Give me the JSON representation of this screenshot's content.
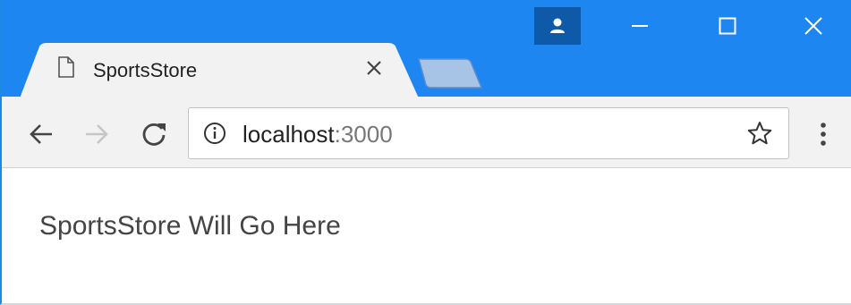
{
  "browser": {
    "tab": {
      "title": "SportsStore",
      "page_icon": "document-icon",
      "close_icon": "close-icon"
    },
    "window_controls": {
      "profile_icon": "person-icon",
      "minimize_icon": "minimize-icon",
      "maximize_icon": "maximize-icon",
      "close_icon": "close-icon"
    },
    "toolbar": {
      "back_icon": "back-arrow-icon",
      "forward_icon": "forward-arrow-icon",
      "reload_icon": "reload-icon",
      "menu_icon": "more-vert-icon"
    },
    "address_bar": {
      "info_icon": "info-icon",
      "host": "localhost",
      "port": ":3000",
      "bookmark_icon": "star-icon"
    }
  },
  "page": {
    "heading": "SportsStore Will Go Here"
  },
  "colors": {
    "titlebar": "#1e86f0",
    "profile_button": "#0f5aa8",
    "toolbar": "#f2f2f2",
    "text": "#444444"
  }
}
